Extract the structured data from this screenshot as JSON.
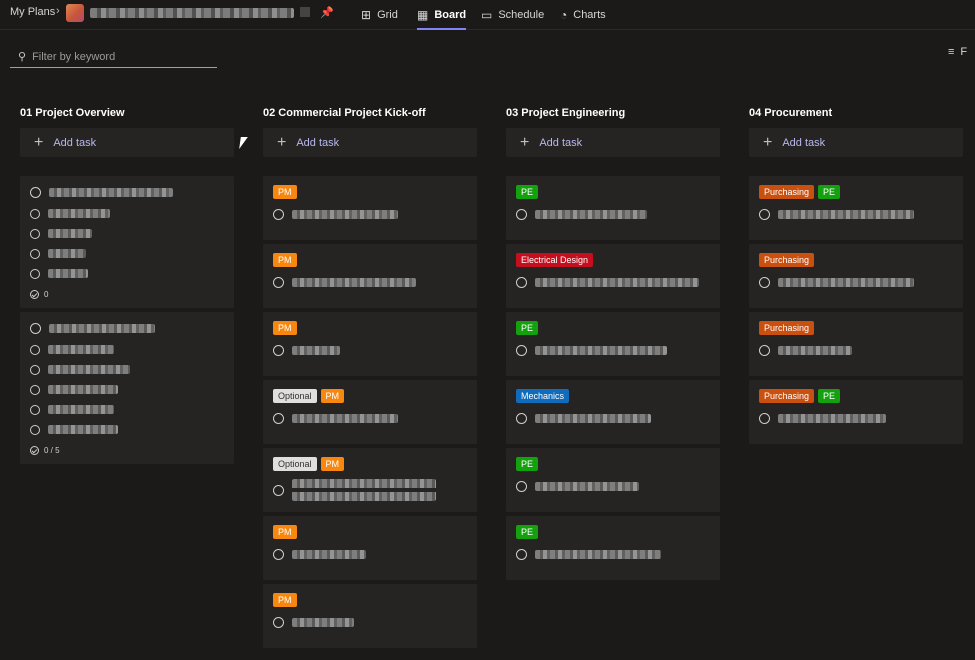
{
  "header": {
    "breadcrumb_root": "My Plans",
    "tabs": [
      {
        "label": "Grid",
        "icon": "grid-icon"
      },
      {
        "label": "Board",
        "icon": "board-icon"
      },
      {
        "label": "Schedule",
        "icon": "calendar-icon"
      },
      {
        "label": "Charts",
        "icon": "chart-icon"
      }
    ],
    "active_tab": "Board"
  },
  "filter": {
    "placeholder": "Filter by keyword",
    "right_label": "F"
  },
  "colors": {
    "accent": "#7f85f5",
    "PM": "#f7870f",
    "PE": "#13a10e",
    "Purchasing": "#ca5010",
    "Electrical Design": "#c50f1f",
    "Mechanics": "#0f6cbd",
    "Optional": "#e1dfdd"
  },
  "board": {
    "add_task_label": "Add task",
    "columns": [
      {
        "title": "01 Project Overview",
        "cards": [
          {
            "labels": [],
            "checklist_items": 4,
            "progress": "0"
          },
          {
            "labels": [],
            "checklist_items": 5,
            "progress": "0 / 5"
          }
        ]
      },
      {
        "title": "02 Commercial Project Kick-off",
        "cards": [
          {
            "labels": [
              "PM"
            ]
          },
          {
            "labels": [
              "PM"
            ]
          },
          {
            "labels": [
              "PM"
            ]
          },
          {
            "labels": [
              "Optional",
              "PM"
            ]
          },
          {
            "labels": [
              "Optional",
              "PM"
            ]
          },
          {
            "labels": [
              "PM"
            ]
          },
          {
            "labels": [
              "PM"
            ]
          }
        ]
      },
      {
        "title": "03 Project Engineering",
        "cards": [
          {
            "labels": [
              "PE"
            ]
          },
          {
            "labels": [
              "Electrical Design"
            ]
          },
          {
            "labels": [
              "PE"
            ]
          },
          {
            "labels": [
              "Mechanics"
            ]
          },
          {
            "labels": [
              "PE"
            ]
          },
          {
            "labels": [
              "PE"
            ]
          }
        ]
      },
      {
        "title": "04 Procurement",
        "cards": [
          {
            "labels": [
              "Purchasing",
              "PE"
            ]
          },
          {
            "labels": [
              "Purchasing"
            ]
          },
          {
            "labels": [
              "Purchasing"
            ]
          },
          {
            "labels": [
              "Purchasing",
              "PE"
            ]
          }
        ]
      }
    ]
  }
}
